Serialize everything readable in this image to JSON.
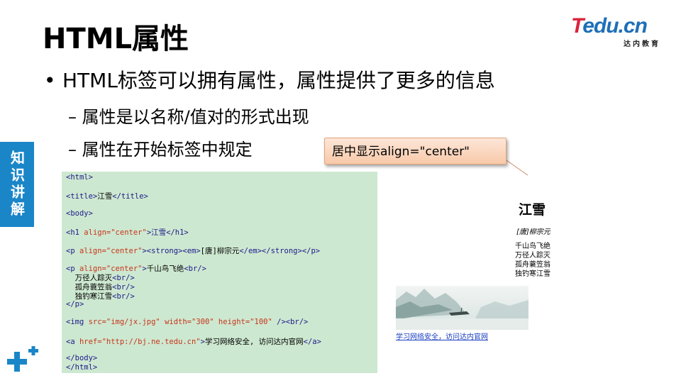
{
  "slide": {
    "title": "HTML属性",
    "bullet": "HTML标签可以拥有属性，属性提供了更多的信息",
    "sub_bullets": [
      "属性是以名称/值对的形式出现",
      "属性在开始标签中规定"
    ],
    "side_tab": "知识讲解",
    "callout": "居中显示align=\"center\""
  },
  "logo": {
    "main_t": "T",
    "main_rest": "edu.cn",
    "subtitle": "达内教育"
  },
  "code": {
    "html_open": "<html>",
    "title_open": "<title>",
    "title_text": "江雪",
    "title_close": "</title>",
    "body_open": "<body>",
    "h1_open": "<h1 ",
    "h1_attr": "align=\"center\"",
    "h1_rest": ">江雪</h1>",
    "p1_open": "<p ",
    "p1_attr": "align=\"center\"",
    "p1_mid": "><strong><em>",
    "p1_text": "[唐]柳宗元",
    "p1_close": "</em></strong></p>",
    "p2_open": "<p ",
    "p2_attr": "align=\"center\"",
    "p2_gt": ">",
    "p2_text": "千山鸟飞绝",
    "p2_br": "<br/>",
    "poem_l2": "万径人踪灭",
    "poem_l3": "孤舟蓑笠翁",
    "poem_l4": "独钓寒江雪",
    "br": "<br/>",
    "p_close": "</p>",
    "img_open": "<img ",
    "img_attr": "src=\"img/jx.jpg\" width=\"300\" height=\"100\"",
    "img_close": " /><br/>",
    "a_open": "<a ",
    "a_attr": "href=\"http://bj.ne.tedu.cn\"",
    "a_gt": ">",
    "a_text": "学习网络安全, 访问达内官网",
    "a_close": "</a>",
    "body_close": "</body>",
    "html_close": "</html>"
  },
  "preview": {
    "h1": "江雪",
    "author": "[唐]柳宗元",
    "poem": [
      "千山鸟飞绝",
      "万径人踪灭",
      "孤舟蓑笠翁",
      "独钓寒江雪"
    ],
    "link": "学习网络安全，访问达内官网"
  },
  "colors": {
    "accent_blue": "#1a86c8",
    "logo_red": "#d9243c",
    "code_bg": "#cde8d0",
    "code_tag": "#1a1a8a",
    "code_attr": "#c8341c",
    "callout_bg": "#f8c9a9"
  }
}
